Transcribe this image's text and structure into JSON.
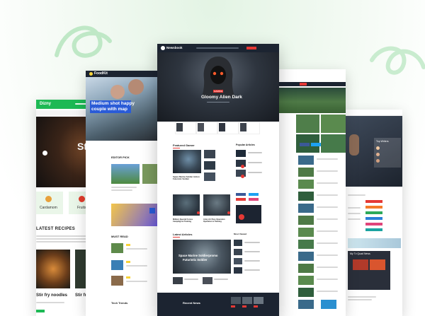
{
  "colors": {
    "accent_green": "#1db954",
    "red": "#e53935",
    "dark_navy": "#1c2431",
    "yellow": "#f7d33a"
  },
  "left_card": {
    "logo": "Dizny",
    "category_1": "Cardamom",
    "category_2": "Fruits",
    "hero_partial": "St",
    "section_title": "LATEST RECIPES",
    "post_1": "Stir fry noodles",
    "post_2": "Stir fr"
  },
  "card2": {
    "logo": "FoodKit",
    "hero_title_line1": "Medium shot happy",
    "hero_title_line2": "couple with map",
    "section_1": "EDITOR PICK",
    "section_2": "MUST READ",
    "section_3": "Tech Trends"
  },
  "center_card": {
    "logo": "Newsbook",
    "hero_badge": "GAMING",
    "hero_title": "Gloomy Alien Dark",
    "section_featured": "Featured Gamer",
    "section_popular": "Popular Articles",
    "featured_main_caption": "Space Marine Soldier Action Futuristic Soldier",
    "featured_bottom_caption": "Military Special Forces Campaign & Training",
    "featured_bottom_caption_2": "Army Air Pass Operation Operation & Training",
    "section_latest": "Latest Articles",
    "section_most_viewed": "Most Viewed",
    "latest_hero_title_line1": "Space Marine Soldierpromo",
    "latest_hero_title_line2": "Futuristic Soldier",
    "section_recent": "Recent News"
  },
  "right_card": {
    "section_title": "Top Writers"
  },
  "right_card_2": {
    "section_title": "My Tv Quad News"
  }
}
